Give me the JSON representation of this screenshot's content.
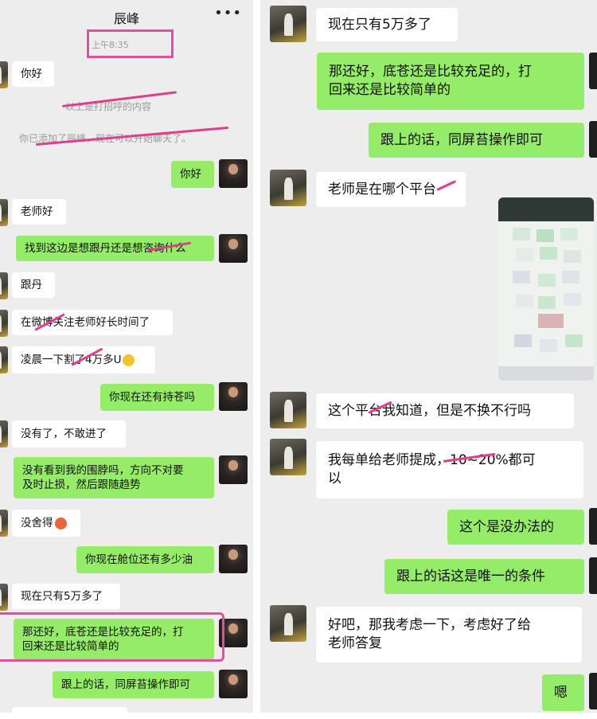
{
  "left": {
    "contact_name": "辰峰",
    "more_icon": "more-icon",
    "timestamp": "上午8:35",
    "sys_greet": "以上是打招呼的内容",
    "sys_added": "你已添加了辰峰，现在可以开始聊天了。",
    "messages": [
      {
        "text": "你好"
      },
      {
        "text": "你好"
      },
      {
        "text": "老师好"
      },
      {
        "text": "找到这边是想跟丹还是想咨询什么"
      },
      {
        "text": "跟丹"
      },
      {
        "text": "在微博关注老师好长时间了"
      },
      {
        "text": "凌晨一下割了4万多U"
      },
      {
        "text": "你现在还有持苍吗"
      },
      {
        "text": "没有了，不敢进了"
      },
      {
        "text": "没有看到我的围脖吗，方向不对要",
        "text2": "及时止损，然后跟随趋势"
      },
      {
        "text": "没舍得"
      },
      {
        "text": "你现在舱位还有多少油"
      },
      {
        "text": "现在只有5万多了"
      },
      {
        "text": "那还好，底苍还是比较充足的，打",
        "text2": "回来还是比较简单的"
      },
      {
        "text": "跟上的话，同屏苔操作即可"
      }
    ]
  },
  "right": {
    "messages": [
      {
        "text": "现在只有5万多了"
      },
      {
        "text": "那还好，底苍还是比较充足的，打",
        "text2": "回来还是比较简单的"
      },
      {
        "text": "跟上的话，同屏苔操作即可"
      },
      {
        "text": "老师是在哪个平台"
      },
      {
        "text": "这个平台我知道，但是不换不行吗"
      },
      {
        "text": "我每单给老师提成，10~20%都可",
        "text2": "以"
      },
      {
        "text": "这个是没办法的"
      },
      {
        "text": "跟上的话这是唯一的条件"
      },
      {
        "text": "好吧，那我考虑一下，考虑好了给",
        "text2": "老师答复"
      },
      {
        "text": "嗯"
      }
    ]
  },
  "colors": {
    "outgoing_bubble": "#95ec69",
    "incoming_bubble": "#ffffff",
    "chat_background": "#ededed",
    "annotation_pink": "#e24f9d"
  }
}
